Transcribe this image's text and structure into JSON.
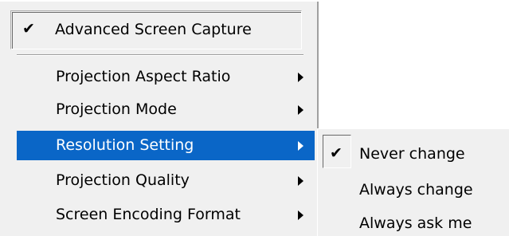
{
  "menu": {
    "checked_item": {
      "label": "Advanced Screen Capture",
      "checked": true
    },
    "items": [
      {
        "label": "Projection Aspect Ratio",
        "has_submenu": true,
        "highlighted": false
      },
      {
        "label": "Projection Mode",
        "has_submenu": true,
        "highlighted": false
      },
      {
        "label": "Resolution Setting",
        "has_submenu": true,
        "highlighted": true
      },
      {
        "label": "Projection Quality",
        "has_submenu": true,
        "highlighted": false
      },
      {
        "label": "Screen Encoding Format",
        "has_submenu": true,
        "highlighted": false
      }
    ]
  },
  "submenu": {
    "items": [
      {
        "label": "Never change",
        "checked": true
      },
      {
        "label": "Always change",
        "checked": false
      },
      {
        "label": "Always ask me",
        "checked": false
      }
    ]
  },
  "icons": {
    "check": "checkmark-icon",
    "submenu_arrow": "chevron-right-icon"
  },
  "colors": {
    "menu_background": "#f0f0f0",
    "highlight": "#0a66c7",
    "highlight_text": "#ffffff",
    "text": "#000000"
  }
}
